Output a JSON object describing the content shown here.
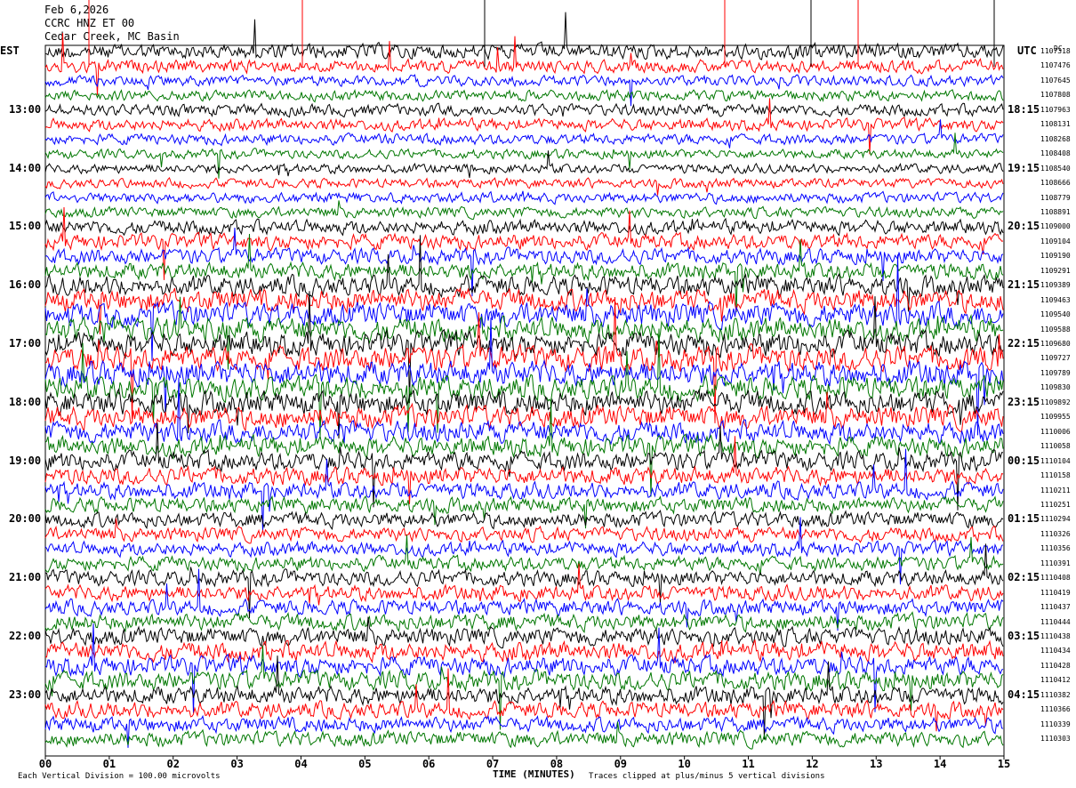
{
  "header": {
    "date": "Feb 6,2026",
    "station": "CCRC HNZ ET 00",
    "location": "Cedar Creek, MC Basin"
  },
  "left_zone": "EST",
  "right_zone": "UTC",
  "dc_label": "DC",
  "footer": {
    "scale_note": "Each Vertical Division = 100.00 microvolts",
    "clip_note": "Traces clipped at plus/minus 5 vertical divisions"
  },
  "colors": {
    "trace_cycle": [
      "#000000",
      "#ff0000",
      "#0000ff",
      "#007700"
    ]
  },
  "chart_data": {
    "type": "line",
    "xlabel": "TIME (MINUTES)",
    "x_ticks": [
      "00",
      "01",
      "02",
      "03",
      "04",
      "05",
      "06",
      "07",
      "08",
      "09",
      "10",
      "11",
      "12",
      "13",
      "14",
      "15"
    ],
    "xlim": [
      0,
      15
    ],
    "rows_per_hour": 4,
    "est_ticks": [
      "13:00",
      "14:00",
      "15:00",
      "16:00",
      "17:00",
      "18:00",
      "19:00",
      "20:00",
      "21:00",
      "22:00",
      "23:00"
    ],
    "utc_ticks": [
      "18:15",
      "19:15",
      "20:15",
      "21:15",
      "22:15",
      "23:15",
      "00:15",
      "01:15",
      "02:15",
      "03:15",
      "04:15"
    ],
    "dc_values": [
      "1107318",
      "1107476",
      "1107645",
      "1107808",
      "1107963",
      "1108131",
      "1108268",
      "1108408",
      "1108540",
      "1108666",
      "1108779",
      "1108891",
      "1109000",
      "1109104",
      "1109190",
      "1109291",
      "1109389",
      "1109463",
      "1109540",
      "1109588",
      "1109680",
      "1109727",
      "1109789",
      "1109830",
      "1109892",
      "1109955",
      "1110006",
      "1110058",
      "1110104",
      "1110158",
      "1110211",
      "1110251",
      "1110294",
      "1110326",
      "1110356",
      "1110391",
      "1110408",
      "1110419",
      "1110437",
      "1110444",
      "1110438",
      "1110434",
      "1110428",
      "1110412",
      "1110382",
      "1110366",
      "1110339",
      "1110303"
    ],
    "activity": [
      1.3,
      1.1,
      0.9,
      0.9,
      1.0,
      1.0,
      0.9,
      0.8,
      0.8,
      0.8,
      0.9,
      0.9,
      1.2,
      1.3,
      1.3,
      1.4,
      1.7,
      1.9,
      2.0,
      2.0,
      2.0,
      2.1,
      2.1,
      2.0,
      2.0,
      1.9,
      1.8,
      1.7,
      1.6,
      1.5,
      1.4,
      1.3,
      1.3,
      1.2,
      1.2,
      1.2,
      1.3,
      1.3,
      1.3,
      1.4,
      1.5,
      1.6,
      1.6,
      1.6,
      1.5,
      1.4,
      1.3,
      1.3
    ]
  }
}
